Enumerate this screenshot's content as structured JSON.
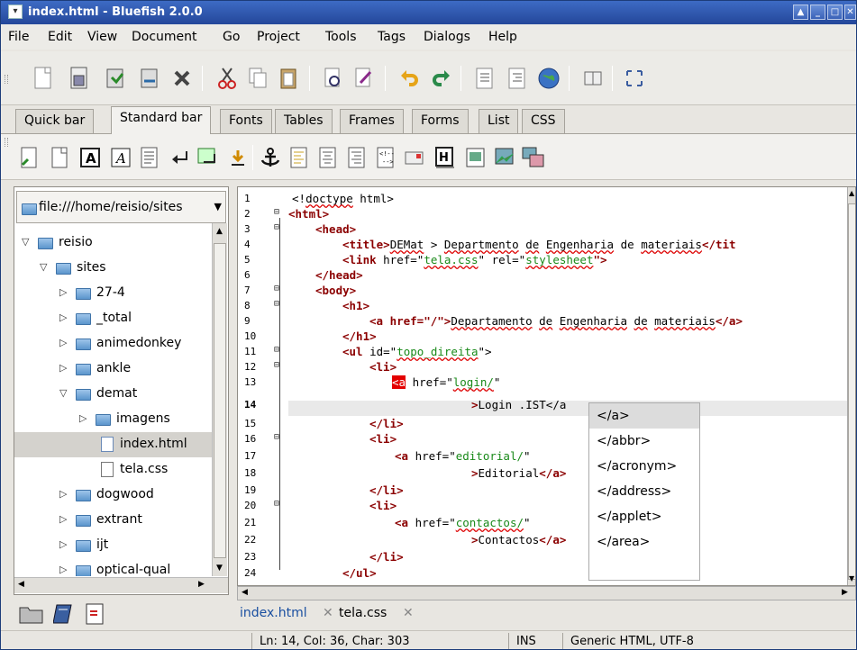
{
  "window": {
    "title": "index.html - Bluefish 2.0.0",
    "buttons": [
      "up",
      "minimize",
      "maximize",
      "close"
    ]
  },
  "menu": [
    "File",
    "Edit",
    "View",
    "Document",
    "Go",
    "Project",
    "Tools",
    "Tags",
    "Dialogs",
    "Help"
  ],
  "toolbar_tabs": [
    "Quick bar",
    "Standard bar",
    "Fonts",
    "Tables",
    "Frames",
    "Forms",
    "List",
    "CSS"
  ],
  "active_toolbar_tab": "Standard bar",
  "sidebar": {
    "path": "file:///home/reisio/sites",
    "tree": [
      {
        "label": "reisio",
        "level": 0,
        "type": "folder",
        "state": "expanded"
      },
      {
        "label": "sites",
        "level": 1,
        "type": "folder",
        "state": "expanded"
      },
      {
        "label": "27-4",
        "level": 2,
        "type": "folder",
        "state": "collapsed"
      },
      {
        "label": "_total",
        "level": 2,
        "type": "folder",
        "state": "collapsed"
      },
      {
        "label": "animedonkey",
        "level": 2,
        "type": "folder",
        "state": "collapsed"
      },
      {
        "label": "ankle",
        "level": 2,
        "type": "folder",
        "state": "collapsed"
      },
      {
        "label": "demat",
        "level": 2,
        "type": "folder",
        "state": "expanded"
      },
      {
        "label": "imagens",
        "level": 3,
        "type": "folder",
        "state": "collapsed"
      },
      {
        "label": "index.html",
        "level": 3,
        "type": "html",
        "state": "selected"
      },
      {
        "label": "tela.css",
        "level": 3,
        "type": "file",
        "state": ""
      },
      {
        "label": "dogwood",
        "level": 2,
        "type": "folder",
        "state": "collapsed"
      },
      {
        "label": "extrant",
        "level": 2,
        "type": "folder",
        "state": "collapsed"
      },
      {
        "label": "ijt",
        "level": 2,
        "type": "folder",
        "state": "collapsed"
      },
      {
        "label": "optical-qual",
        "level": 2,
        "type": "folder",
        "state": "collapsed"
      }
    ]
  },
  "editor": {
    "line_numbers": [
      "1",
      "2",
      "3",
      "4",
      "5",
      "6",
      "7",
      "8",
      "9",
      "10",
      "11",
      "12",
      "13",
      "14",
      "15",
      "16",
      "17",
      "18",
      "19",
      "20",
      "21",
      "22",
      "23",
      "24"
    ],
    "current_line": "14",
    "lines": {
      "l1a": "<!",
      "l1b": "doctype",
      "l1c": " html>",
      "l2": "<html>",
      "l3": "<head>",
      "l4a": "<title>",
      "l4b": "DEMat",
      "l4c": " > ",
      "l4d": "Departmento",
      "l4e": " ",
      "l4f": "de",
      "l4g": " ",
      "l4h": "Engenharia",
      "l4i": " de ",
      "l4j": "materiais",
      "l4k": "</tit",
      "l5a": "<link ",
      "l5b": "href=\"",
      "l5c": "tela.css",
      "l5d": "\" rel=\"",
      "l5e": "stylesheet",
      "l5f": "\">",
      "l6": "</head>",
      "l7": "<body>",
      "l8": "<h1>",
      "l9a": "<a ",
      "l9b": "href=\"/\">",
      "l9c": "Departamento",
      "l9d": " ",
      "l9e": "de",
      "l9f": " ",
      "l9g": "Engenharia",
      "l9h": " ",
      "l9i": "de",
      "l9j": " ",
      "l9k": "materiais",
      "l9l": "</a>",
      "l10": "</h1>",
      "l11a": "<ul ",
      "l11b": "id=\"",
      "l11c": "topo_direita",
      "l11d": "\">",
      "l12": "<li>",
      "l13a": "<a",
      "l13b": " href=\"",
      "l13c": "login/",
      "l13d": "\"",
      "l14a": ">",
      "l14b": "Login .IST</a",
      "l15": "</li>",
      "l16": "<li>",
      "l17a": "<a ",
      "l17b": "href=\"",
      "l17c": "editorial/",
      "l17d": "\"",
      "l18a": ">",
      "l18b": "Editorial",
      "l18c": "</a>",
      "l19": "</li>",
      "l20": "<li>",
      "l21a": "<a ",
      "l21b": "href=\"",
      "l21c": "contactos/",
      "l21d": "\"",
      "l22a": ">",
      "l22b": "Contactos",
      "l22c": "</a>",
      "l23": "</li>",
      "l24": "</ul>"
    }
  },
  "autocomplete": [
    "</a>",
    "</abbr>",
    "</acronym>",
    "</address>",
    "</applet>",
    "</area>"
  ],
  "doc_tabs": [
    {
      "label": "index.html",
      "active": true
    },
    {
      "label": "tela.css",
      "active": false
    }
  ],
  "status": {
    "position": "Ln: 14, Col: 36, Char: 303",
    "mode": "INS",
    "doctype": "Generic HTML, UTF-8"
  },
  "colors": {
    "title_bar": "#2f5bb7",
    "tag": "#8b0000",
    "string": "#1a8a1a",
    "highlight": "#e30000"
  }
}
